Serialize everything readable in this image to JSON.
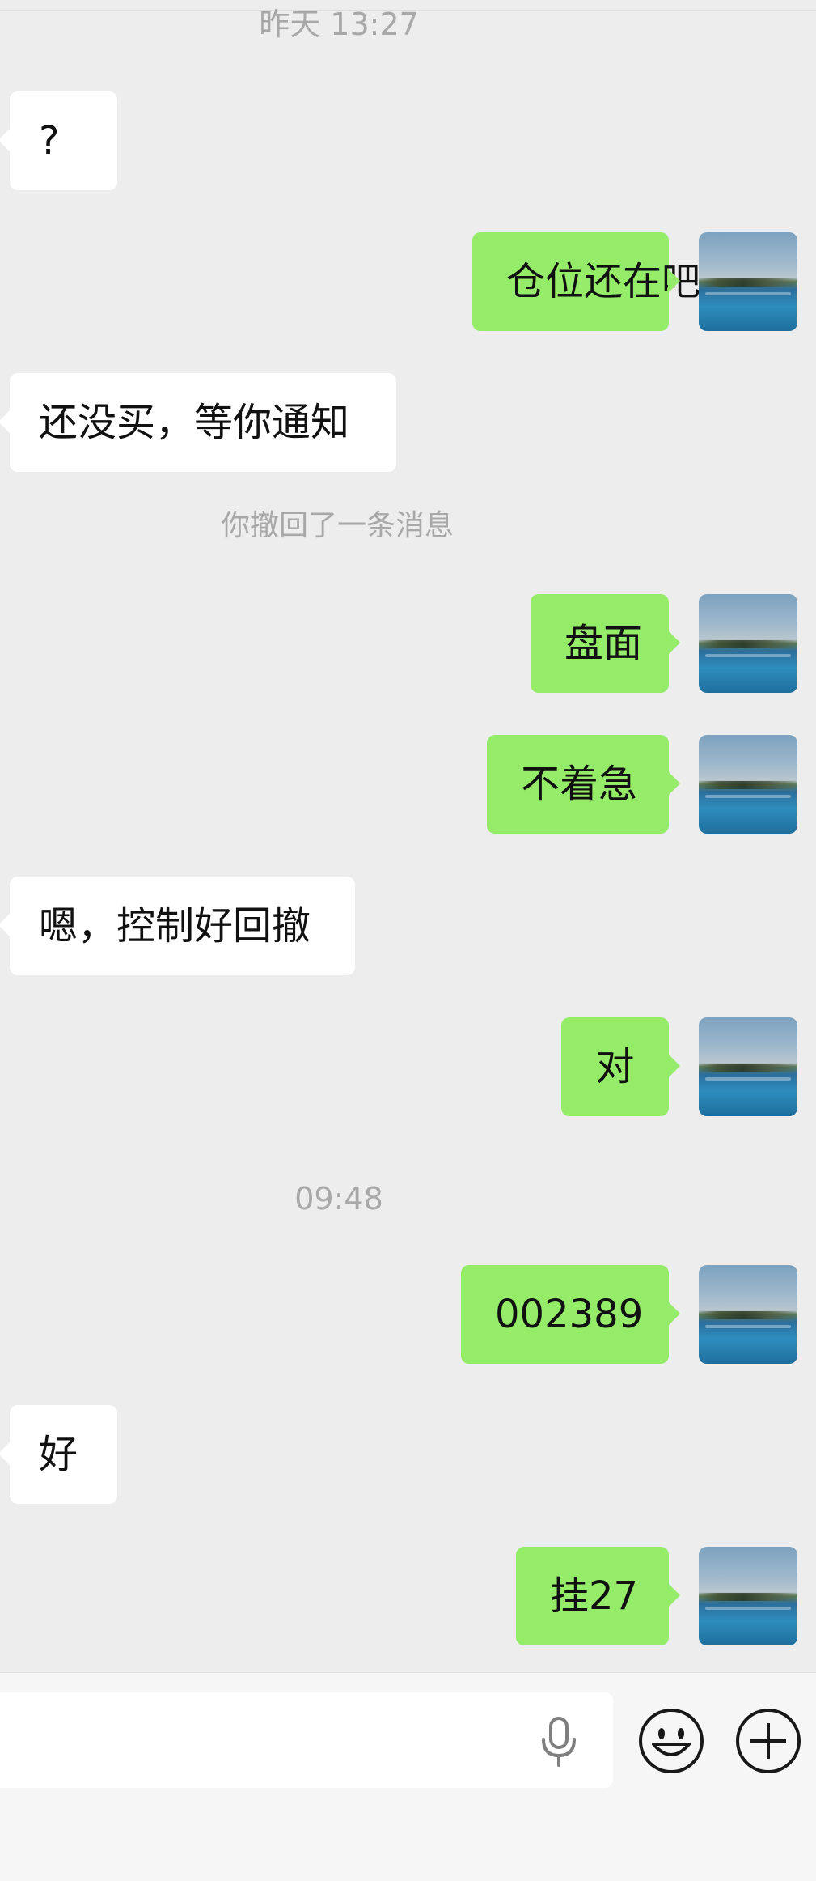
{
  "chat": {
    "timestamp_1": "昨天 13:27",
    "msg_1": "?",
    "msg_2": "仓位还在吧",
    "msg_3": "还没买，等你通知",
    "recall_notice": "你撤回了一条消息",
    "msg_4": "盘面",
    "msg_5": "不着急",
    "msg_6": "嗯，控制好回撤",
    "msg_7": "对",
    "timestamp_2": "09:48",
    "msg_8": "002389",
    "msg_9": "好",
    "msg_10": "挂27"
  },
  "input_bar": {
    "icons": [
      "microphone-icon",
      "emoji-icon",
      "plus-icon"
    ]
  },
  "colors": {
    "background": "#ededed",
    "sent_bubble": "#95ec69",
    "received_bubble": "#ffffff",
    "timestamp_text": "#a8a8a8"
  }
}
